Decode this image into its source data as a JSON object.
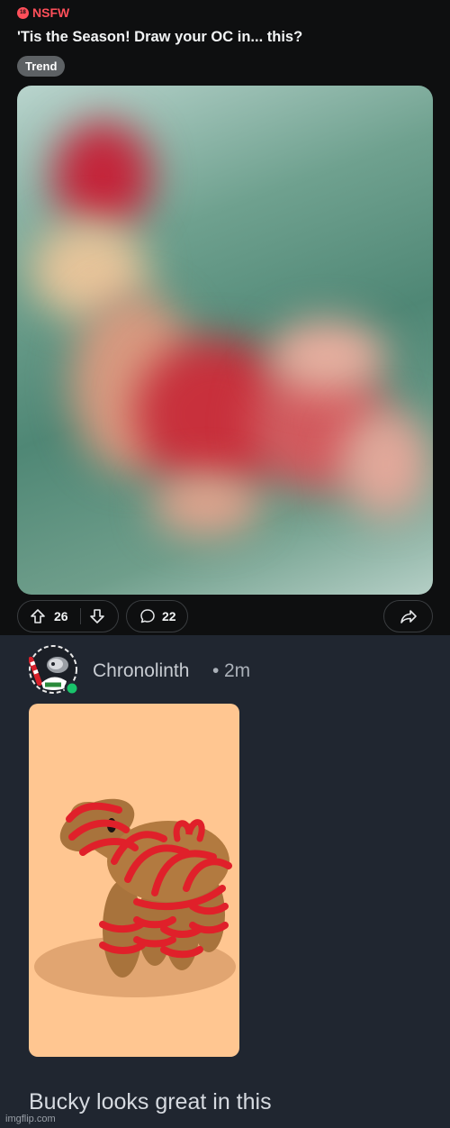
{
  "post": {
    "nsfw_badge": "NSFW",
    "nsfw_icon_text": "18",
    "title": "'Tis the Season! Draw your OC in... this?",
    "flair": "Trend",
    "upvotes": "26",
    "comments": "22"
  },
  "comment": {
    "author": "Chronolinth",
    "separator": "•",
    "age": "2m",
    "text": "Bucky looks great in this"
  },
  "watermark": "imgflip.com",
  "colors": {
    "nsfw": "#ff4f5a",
    "page_dark": "#0e0f10",
    "comment_bg": "#202630",
    "flair_bg": "#5d6164",
    "online_dot": "#19c46b",
    "image_bg": "#ffc691",
    "ribbon": "#e0202a",
    "horse_body": "#a8733c"
  },
  "icons": {
    "nsfw": "nsfw-18-icon",
    "upvote": "arrow-up-icon",
    "downvote": "arrow-down-icon",
    "comment": "comment-bubble-icon",
    "share": "share-arrow-icon"
  }
}
